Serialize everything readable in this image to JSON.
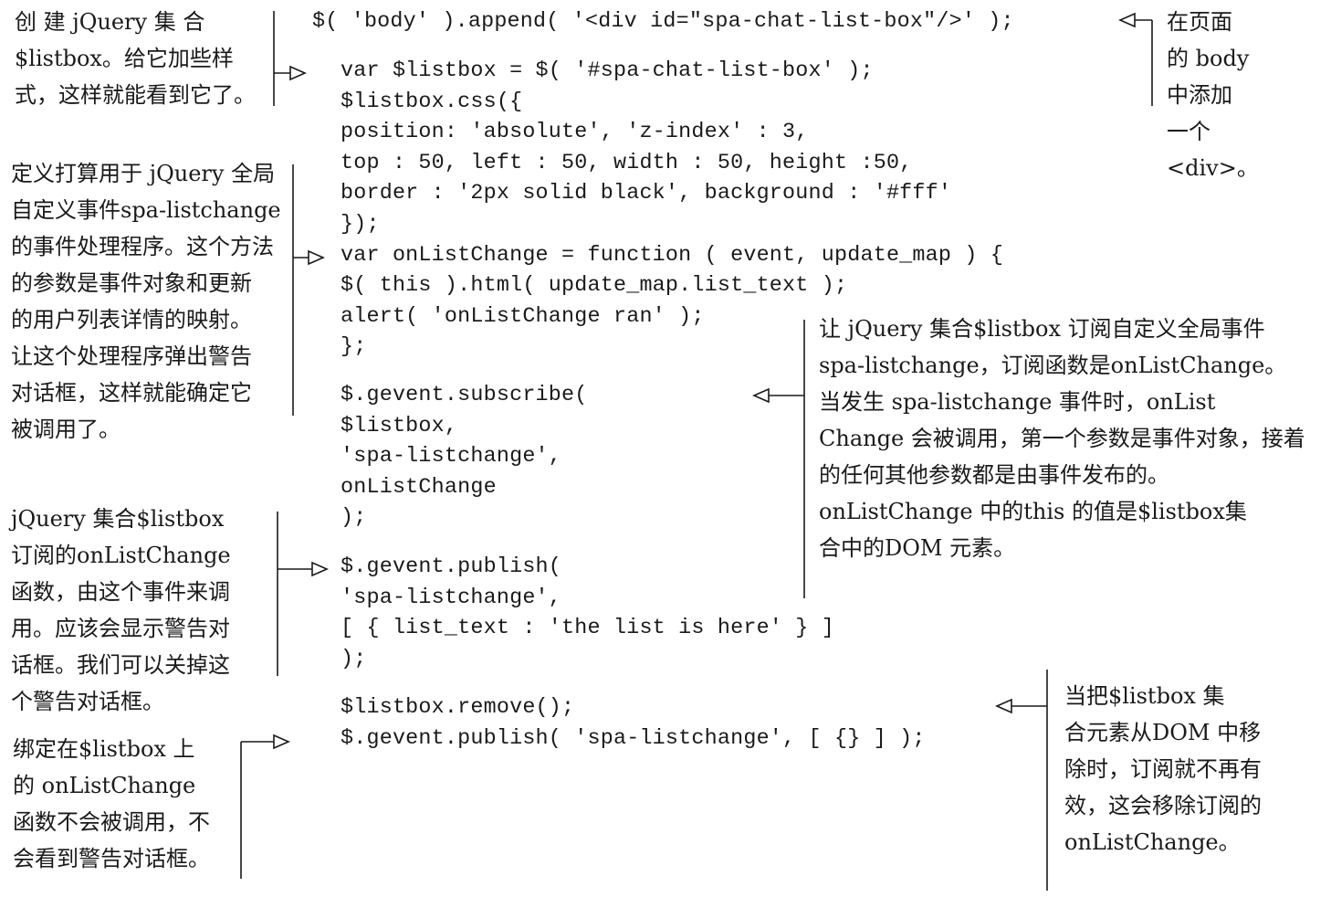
{
  "code": {
    "block1": [
      "$( 'body' ).append( '<div id=\"spa-chat-list-box\"/>' );"
    ],
    "block2": [
      "var $listbox = $( '#spa-chat-list-box' );",
      "$listbox.css({",
      "  position: 'absolute', 'z-index' : 3,",
      "  top : 50, left : 50, width : 50, height :50,",
      "  border : '2px solid black', background : '#fff'",
      "});",
      "var onListChange = function ( event, update_map ) {",
      "  $( this ).html( update_map.list_text );",
      "  alert( 'onListChange ran' );",
      "};"
    ],
    "block3": [
      "$.gevent.subscribe(",
      "  $listbox,",
      "  'spa-listchange',",
      "  onListChange",
      ");"
    ],
    "block4": [
      "$.gevent.publish(",
      "  'spa-listchange',",
      "  [ { list_text : 'the list is here' } ]",
      ");"
    ],
    "block5": [
      "$listbox.remove();",
      "$.gevent.publish( 'spa-listchange', [ {} ] );"
    ]
  },
  "annotations": {
    "create_listbox": [
      "创 建 jQuery 集 合",
      "$listbox。给它加些样",
      "式，这样就能看到它了。"
    ],
    "add_div": [
      "在页面",
      "的 body",
      "中添加",
      "一个",
      "<div>。"
    ],
    "define_handler": [
      "定义打算用于 jQuery 全局",
      "自定义事件spa-listchange",
      "的事件处理程序。这个方法",
      "的参数是事件对象和更新",
      "的用户列表详情的映射。",
      "让这个处理程序弹出警告",
      "对话框，这样就能确定它",
      "被调用了。"
    ],
    "subscribe": [
      "让 jQuery 集合$listbox 订阅自定义全局事件",
      "spa-listchange，订阅函数是onListChange。",
      "当发生 spa-listchange 事件时，onList",
      "Change 会被调用，第一个参数是事件对象，接着",
      "的任何其他参数都是由事件发布的。",
      "onListChange 中的this 的值是$listbox集",
      "合中的DOM 元素。"
    ],
    "publish": [
      "jQuery 集合$listbox",
      "订阅的onListChange",
      "函数，由这个事件来调",
      "用。应该会显示警告对",
      "话框。我们可以关掉这",
      "个警告对话框。"
    ],
    "remove": [
      "当把$listbox 集",
      "合元素从DOM 中移",
      "除时，订阅就不再有",
      "效，这会移除订阅的",
      "onListChange。"
    ],
    "no_call": [
      "绑定在$listbox 上",
      "的 onListChange",
      "函数不会被调用，不",
      "会看到警告对话框。"
    ]
  }
}
